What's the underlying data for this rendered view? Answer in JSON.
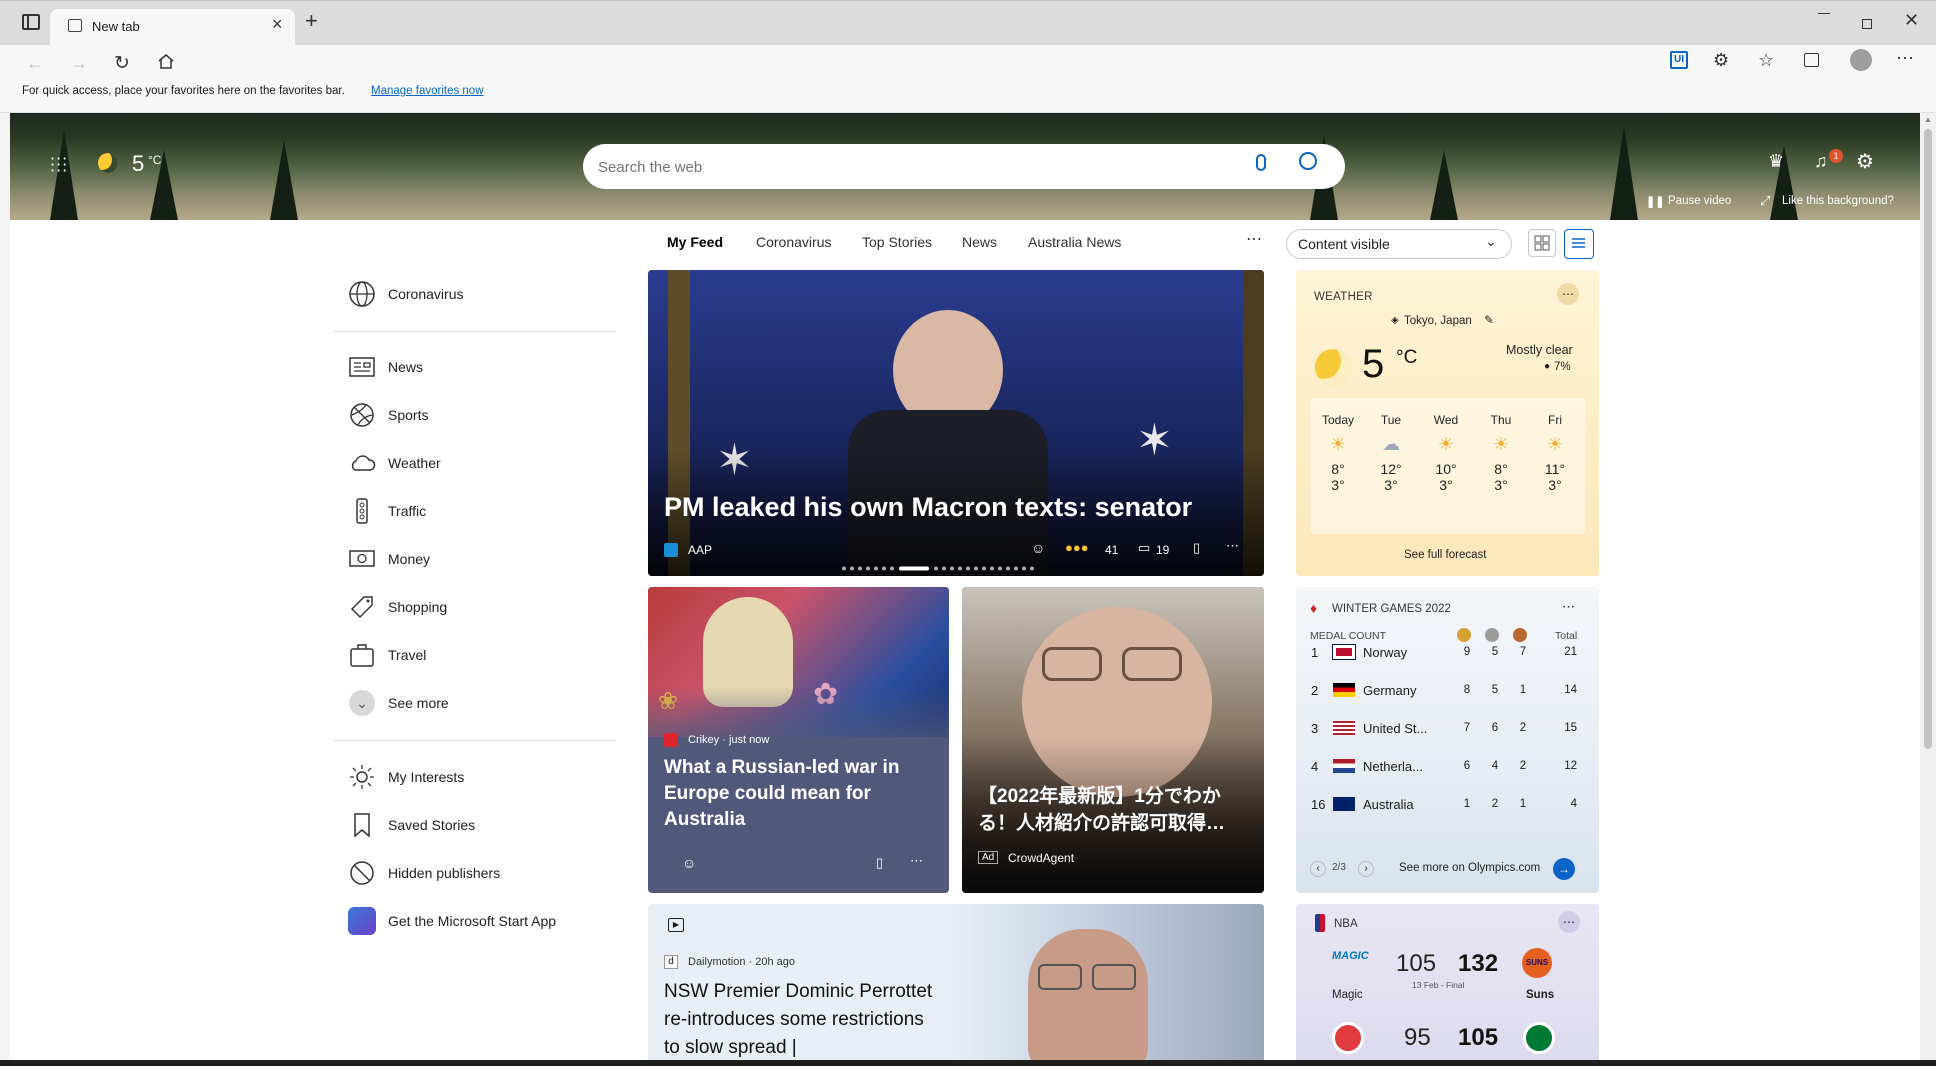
{
  "browser": {
    "tab_title": "New tab",
    "address_placeholder": "",
    "favbar_text": "For quick access, place your favorites here on the favorites bar.",
    "favbar_link": "Manage favorites now"
  },
  "header": {
    "temperature": "5",
    "temp_unit": "°C",
    "search_placeholder": "Search the web",
    "notification_count": "1",
    "pause_video": "Pause video",
    "like_background": "Like this background?"
  },
  "feed_tabs": [
    "My Feed",
    "Coronavirus",
    "Top Stories",
    "News",
    "Australia News"
  ],
  "content_visibility": "Content visible",
  "sidebar": {
    "top_item": "Coronavirus",
    "items": [
      "News",
      "Sports",
      "Weather",
      "Traffic",
      "Money",
      "Shopping",
      "Travel",
      "See more"
    ],
    "bottom_items": [
      "My Interests",
      "Saved Stories",
      "Hidden publishers",
      "Get the Microsoft Start App"
    ]
  },
  "hero_story": {
    "headline": "PM leaked his own Macron texts: senator",
    "source": "AAP",
    "reactions": "41",
    "comments": "19"
  },
  "story2": {
    "source": "Crikey · just now",
    "headline": "What a Russian-led war in Europe could mean for Australia"
  },
  "ad_story": {
    "headline": "【2022年最新版】1分でわかる！人材紹介の許認可取得…",
    "ad_label": "Ad",
    "advertiser": "CrowdAgent"
  },
  "story3": {
    "source": "Dailymotion · 20h ago",
    "headline": "NSW Premier Dominic Perrottet re-introduces some restrictions to slow spread |"
  },
  "weather": {
    "title": "WEATHER",
    "location": "Tokyo, Japan",
    "temp": "5",
    "unit": "°C",
    "condition": "Mostly clear",
    "precip": "7%",
    "days": [
      {
        "day": "Today",
        "high": "8°",
        "low": "3°"
      },
      {
        "day": "Tue",
        "high": "12°",
        "low": "3°"
      },
      {
        "day": "Wed",
        "high": "10°",
        "low": "3°"
      },
      {
        "day": "Thu",
        "high": "8°",
        "low": "3°"
      },
      {
        "day": "Fri",
        "high": "11°",
        "low": "3°"
      }
    ],
    "full_forecast": "See full forecast"
  },
  "winter_games": {
    "title": "WINTER GAMES 2022",
    "medal_count": "MEDAL COUNT",
    "total": "Total",
    "rows": [
      {
        "rank": "1",
        "country": "Norway",
        "gold": "9",
        "silver": "5",
        "bronze": "7",
        "total": "21"
      },
      {
        "rank": "2",
        "country": "Germany",
        "gold": "8",
        "silver": "5",
        "bronze": "1",
        "total": "14"
      },
      {
        "rank": "3",
        "country": "United St...",
        "gold": "7",
        "silver": "6",
        "bronze": "2",
        "total": "15"
      },
      {
        "rank": "4",
        "country": "Netherla...",
        "gold": "6",
        "silver": "4",
        "bronze": "2",
        "total": "12"
      },
      {
        "rank": "16",
        "country": "Australia",
        "gold": "1",
        "silver": "2",
        "bronze": "1",
        "total": "4"
      }
    ],
    "pager": "2/3",
    "see_more": "See more on Olympics.com"
  },
  "nba": {
    "title": "NBA",
    "game1": {
      "team1": "Magic",
      "score1": "105",
      "score2": "132",
      "team2": "Suns",
      "date": "13 Feb - Final"
    },
    "game2": {
      "score1": "95",
      "score2": "105"
    }
  },
  "colors": {
    "accent": "#0a64c8",
    "brand_red": "#c4262e"
  }
}
